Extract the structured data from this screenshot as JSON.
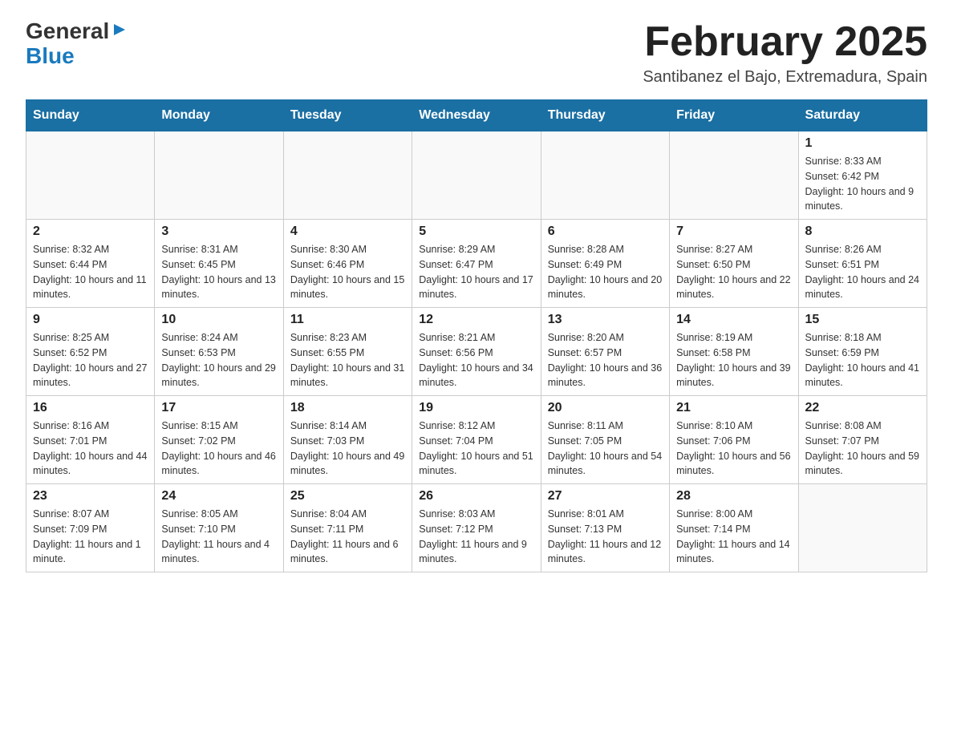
{
  "logo": {
    "general": "General",
    "blue": "Blue"
  },
  "title": "February 2025",
  "location": "Santibanez el Bajo, Extremadura, Spain",
  "weekdays": [
    "Sunday",
    "Monday",
    "Tuesday",
    "Wednesday",
    "Thursday",
    "Friday",
    "Saturday"
  ],
  "weeks": [
    [
      {
        "day": "",
        "info": ""
      },
      {
        "day": "",
        "info": ""
      },
      {
        "day": "",
        "info": ""
      },
      {
        "day": "",
        "info": ""
      },
      {
        "day": "",
        "info": ""
      },
      {
        "day": "",
        "info": ""
      },
      {
        "day": "1",
        "info": "Sunrise: 8:33 AM\nSunset: 6:42 PM\nDaylight: 10 hours and 9 minutes."
      }
    ],
    [
      {
        "day": "2",
        "info": "Sunrise: 8:32 AM\nSunset: 6:44 PM\nDaylight: 10 hours and 11 minutes."
      },
      {
        "day": "3",
        "info": "Sunrise: 8:31 AM\nSunset: 6:45 PM\nDaylight: 10 hours and 13 minutes."
      },
      {
        "day": "4",
        "info": "Sunrise: 8:30 AM\nSunset: 6:46 PM\nDaylight: 10 hours and 15 minutes."
      },
      {
        "day": "5",
        "info": "Sunrise: 8:29 AM\nSunset: 6:47 PM\nDaylight: 10 hours and 17 minutes."
      },
      {
        "day": "6",
        "info": "Sunrise: 8:28 AM\nSunset: 6:49 PM\nDaylight: 10 hours and 20 minutes."
      },
      {
        "day": "7",
        "info": "Sunrise: 8:27 AM\nSunset: 6:50 PM\nDaylight: 10 hours and 22 minutes."
      },
      {
        "day": "8",
        "info": "Sunrise: 8:26 AM\nSunset: 6:51 PM\nDaylight: 10 hours and 24 minutes."
      }
    ],
    [
      {
        "day": "9",
        "info": "Sunrise: 8:25 AM\nSunset: 6:52 PM\nDaylight: 10 hours and 27 minutes."
      },
      {
        "day": "10",
        "info": "Sunrise: 8:24 AM\nSunset: 6:53 PM\nDaylight: 10 hours and 29 minutes."
      },
      {
        "day": "11",
        "info": "Sunrise: 8:23 AM\nSunset: 6:55 PM\nDaylight: 10 hours and 31 minutes."
      },
      {
        "day": "12",
        "info": "Sunrise: 8:21 AM\nSunset: 6:56 PM\nDaylight: 10 hours and 34 minutes."
      },
      {
        "day": "13",
        "info": "Sunrise: 8:20 AM\nSunset: 6:57 PM\nDaylight: 10 hours and 36 minutes."
      },
      {
        "day": "14",
        "info": "Sunrise: 8:19 AM\nSunset: 6:58 PM\nDaylight: 10 hours and 39 minutes."
      },
      {
        "day": "15",
        "info": "Sunrise: 8:18 AM\nSunset: 6:59 PM\nDaylight: 10 hours and 41 minutes."
      }
    ],
    [
      {
        "day": "16",
        "info": "Sunrise: 8:16 AM\nSunset: 7:01 PM\nDaylight: 10 hours and 44 minutes."
      },
      {
        "day": "17",
        "info": "Sunrise: 8:15 AM\nSunset: 7:02 PM\nDaylight: 10 hours and 46 minutes."
      },
      {
        "day": "18",
        "info": "Sunrise: 8:14 AM\nSunset: 7:03 PM\nDaylight: 10 hours and 49 minutes."
      },
      {
        "day": "19",
        "info": "Sunrise: 8:12 AM\nSunset: 7:04 PM\nDaylight: 10 hours and 51 minutes."
      },
      {
        "day": "20",
        "info": "Sunrise: 8:11 AM\nSunset: 7:05 PM\nDaylight: 10 hours and 54 minutes."
      },
      {
        "day": "21",
        "info": "Sunrise: 8:10 AM\nSunset: 7:06 PM\nDaylight: 10 hours and 56 minutes."
      },
      {
        "day": "22",
        "info": "Sunrise: 8:08 AM\nSunset: 7:07 PM\nDaylight: 10 hours and 59 minutes."
      }
    ],
    [
      {
        "day": "23",
        "info": "Sunrise: 8:07 AM\nSunset: 7:09 PM\nDaylight: 11 hours and 1 minute."
      },
      {
        "day": "24",
        "info": "Sunrise: 8:05 AM\nSunset: 7:10 PM\nDaylight: 11 hours and 4 minutes."
      },
      {
        "day": "25",
        "info": "Sunrise: 8:04 AM\nSunset: 7:11 PM\nDaylight: 11 hours and 6 minutes."
      },
      {
        "day": "26",
        "info": "Sunrise: 8:03 AM\nSunset: 7:12 PM\nDaylight: 11 hours and 9 minutes."
      },
      {
        "day": "27",
        "info": "Sunrise: 8:01 AM\nSunset: 7:13 PM\nDaylight: 11 hours and 12 minutes."
      },
      {
        "day": "28",
        "info": "Sunrise: 8:00 AM\nSunset: 7:14 PM\nDaylight: 11 hours and 14 minutes."
      },
      {
        "day": "",
        "info": ""
      }
    ]
  ]
}
